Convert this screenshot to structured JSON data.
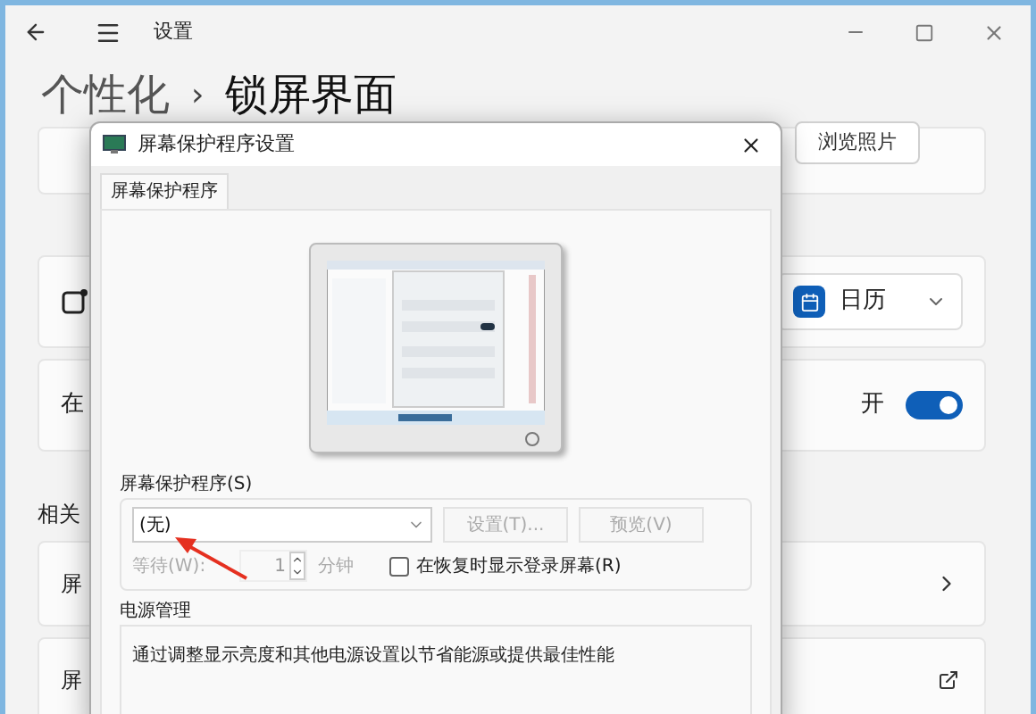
{
  "settings_window": {
    "title": "设置",
    "breadcrumb": [
      {
        "label": "个性化"
      },
      {
        "label": "锁屏界面"
      }
    ],
    "breadcrumb_separator": "›"
  },
  "cards": [
    {
      "kind": "button",
      "button": "浏览照片"
    },
    {
      "kind": "dropdown",
      "value": "日历"
    },
    {
      "kind": "toggle",
      "label": "在",
      "state_label": "开",
      "on": true
    }
  ],
  "related": {
    "heading": "相关",
    "items": [
      {
        "label": "屏",
        "kind": "chevron"
      },
      {
        "label": "屏",
        "kind": "external"
      }
    ]
  },
  "dialog": {
    "title": "屏幕保护程序设置",
    "tabs": [
      {
        "label": "屏幕保护程序",
        "selected": true
      }
    ],
    "screensaver": {
      "group_label": "屏幕保护程序(S)",
      "value": "(无)",
      "settings_button": "设置(T)...",
      "preview_button": "预览(V)",
      "wait_label": "等待(W):",
      "wait_value": "1",
      "wait_unit": "分钟",
      "disabled": true,
      "resume_checkbox": {
        "label": "在恢复时显示登录屏幕(R)",
        "checked": false
      }
    },
    "power": {
      "heading": "电源管理",
      "text": "通过调整显示亮度和其他电源设置以节省能源或提供最佳性能"
    }
  }
}
